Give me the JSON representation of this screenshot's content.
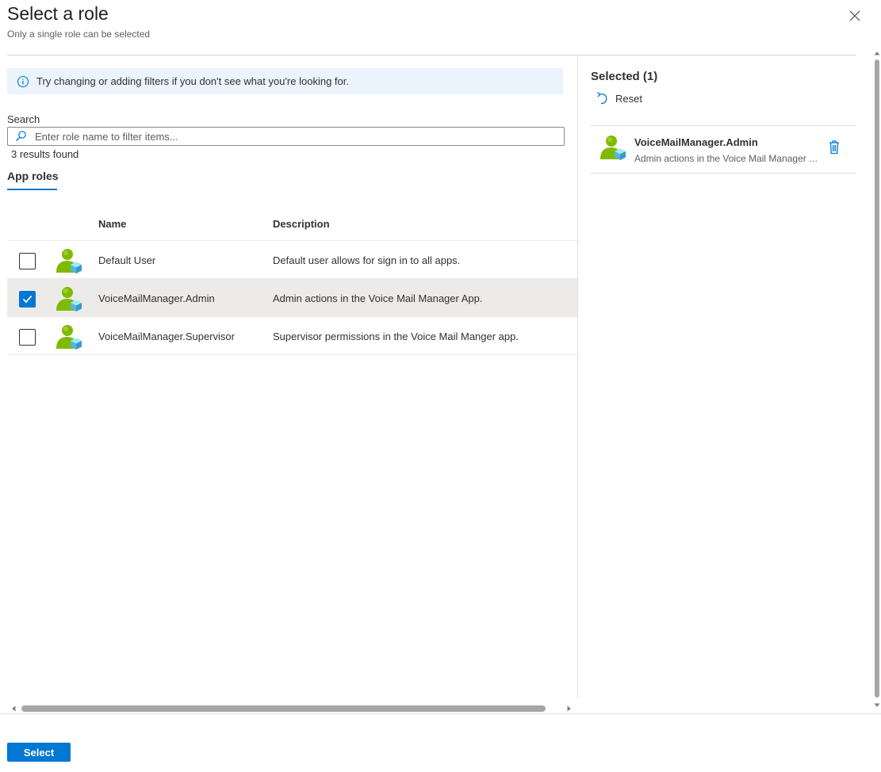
{
  "header": {
    "title": "Select a role",
    "subtitle": "Only a single role can be selected"
  },
  "info_bar": {
    "message": "Try changing or adding filters if you don't see what you're looking for."
  },
  "search": {
    "label": "Search",
    "placeholder": "Enter role name to filter items...",
    "value": "",
    "result_count": "3 results found"
  },
  "tabs": [
    {
      "label": "App roles",
      "active": true
    }
  ],
  "table": {
    "columns": [
      "Name",
      "Description"
    ],
    "rows": [
      {
        "name": "Default User",
        "description": "Default user allows for sign in to all apps.",
        "checked": false
      },
      {
        "name": "VoiceMailManager.Admin",
        "description": "Admin actions in the Voice Mail Manager App.",
        "checked": true
      },
      {
        "name": "VoiceMailManager.Supervisor",
        "description": "Supervisor permissions in the Voice Mail Manger app.",
        "checked": false
      }
    ]
  },
  "selected_panel": {
    "title": "Selected (1)",
    "reset_label": "Reset",
    "items": [
      {
        "name": "VoiceMailManager.Admin",
        "description": "Admin actions in the Voice Mail Manager App."
      }
    ]
  },
  "footer": {
    "select_label": "Select"
  },
  "colors": {
    "accent": "#0078d4",
    "info_bg": "#ebf3fc",
    "selected_row_bg": "#edebe9"
  },
  "icons": {
    "close": "close-icon",
    "info": "info-icon",
    "search": "search-icon",
    "role": "app-role-user-icon",
    "reset": "undo-icon",
    "delete": "trash-icon",
    "check": "checkmark-icon"
  }
}
